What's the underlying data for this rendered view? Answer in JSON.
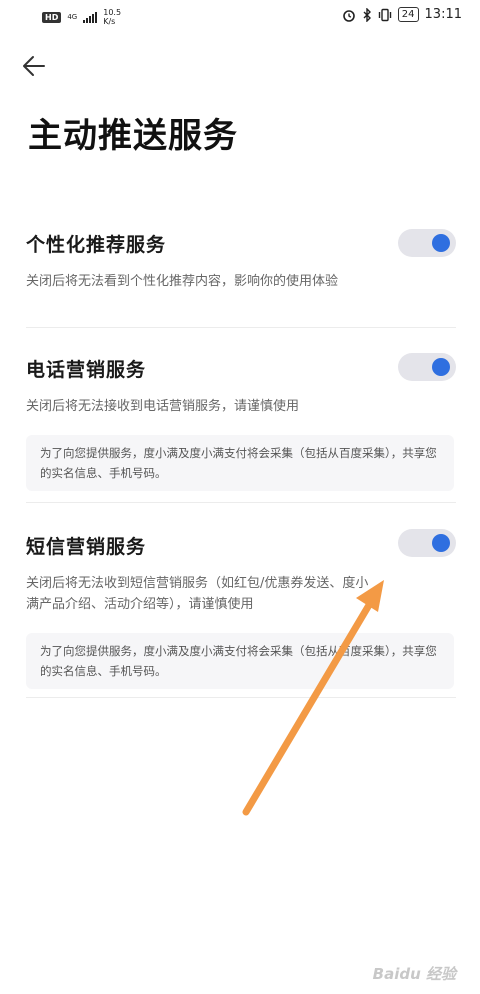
{
  "status_bar": {
    "hd": "HD",
    "net_type": "4G",
    "speed_value": "10.5",
    "speed_unit": "K/s",
    "battery": "24",
    "time": "13:11"
  },
  "page": {
    "title": "主动推送服务"
  },
  "services": [
    {
      "title": "个性化推荐服务",
      "description": "关闭后将无法看到个性化推荐内容，影响你的使用体验",
      "enabled": true
    },
    {
      "title": "电话营销服务",
      "description": "关闭后将无法接收到电话营销服务，请谨慎使用",
      "note": "为了向您提供服务，度小满及度小满支付将会采集（包括从百度采集），共享您的实名信息、手机号码。",
      "enabled": true
    },
    {
      "title": "短信营销服务",
      "description": "关闭后将无法收到短信营销服务（如红包/优惠券发送、度小满产品介绍、活动介绍等），请谨慎使用",
      "note": "为了向您提供服务，度小满及度小满支付将会采集（包括从百度采集），共享您的实名信息、手机号码。",
      "enabled": true
    }
  ],
  "watermark": "Baidu 经验",
  "colors": {
    "toggle_on_knob": "#2f6fe0",
    "toggle_track": "#e4e4ea",
    "annotation_arrow": "#f39a45"
  },
  "icons": {
    "back": "back-arrow-icon",
    "alarm": "alarm-icon",
    "bluetooth": "bluetooth-icon",
    "vibrate": "vibrate-icon"
  }
}
